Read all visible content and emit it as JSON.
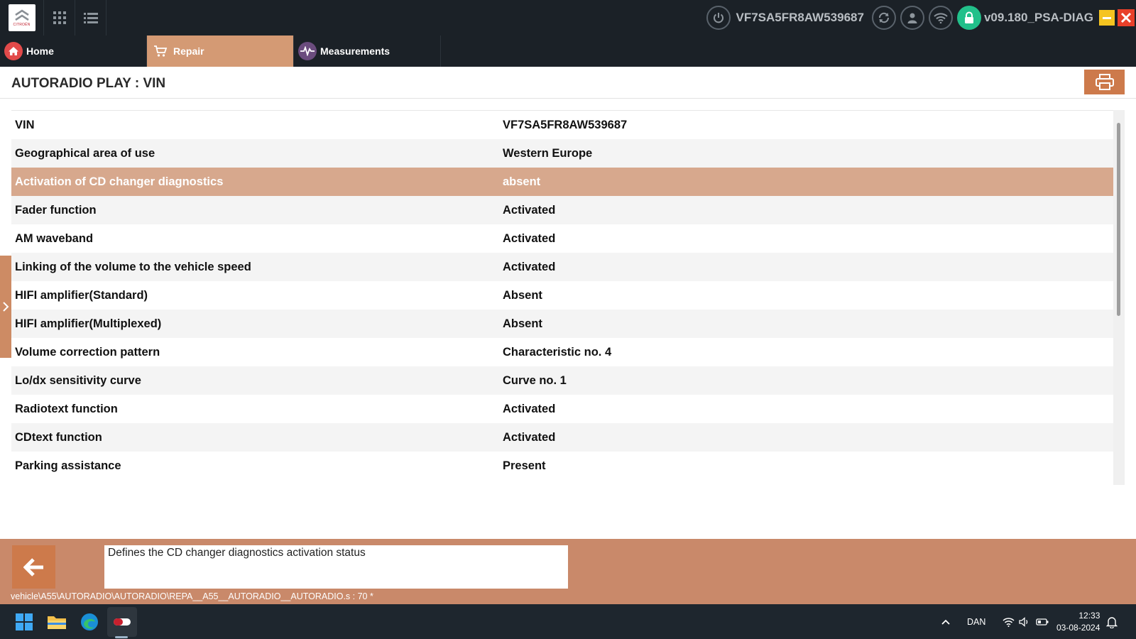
{
  "header": {
    "logo_brand": "CITROËN",
    "vin": "VF7SA5FR8AW539687",
    "version": "v09.180_PSA-DIAG",
    "icons": [
      "citroen-logo",
      "apps-grid-icon",
      "list-icon",
      "power-icon",
      "refresh-icon",
      "user-icon",
      "wifi-icon",
      "lock-icon",
      "minimize-icon",
      "close-icon"
    ]
  },
  "nav": {
    "tabs": [
      {
        "label": "Home",
        "icon": "home-icon"
      },
      {
        "label": "Repair",
        "icon": "cart-icon"
      },
      {
        "label": "Measurements",
        "icon": "pulse-icon"
      }
    ],
    "active_tab": "Repair"
  },
  "page": {
    "title": "AUTORADIO PLAY : VIN"
  },
  "table": {
    "rows": [
      {
        "label": "VIN",
        "value": "VF7SA5FR8AW539687"
      },
      {
        "label": "Geographical area of use",
        "value": "Western Europe"
      },
      {
        "label": "Activation of CD changer diagnostics",
        "value": "absent"
      },
      {
        "label": "Fader function",
        "value": "Activated"
      },
      {
        "label": "AM waveband",
        "value": "Activated"
      },
      {
        "label": "Linking of the volume to the vehicle speed",
        "value": "Activated"
      },
      {
        "label": "HIFI amplifier(Standard)",
        "value": "Absent"
      },
      {
        "label": "HIFI amplifier(Multiplexed)",
        "value": "Absent"
      },
      {
        "label": "Volume correction pattern",
        "value": "Characteristic no. 4"
      },
      {
        "label": "Lo/dx sensitivity curve",
        "value": "Curve no. 1"
      },
      {
        "label": "Radiotext function",
        "value": "Activated"
      },
      {
        "label": "CDtext function",
        "value": "Activated"
      },
      {
        "label": "Parking assistance",
        "value": "Present"
      }
    ],
    "selected_row": "Activation of CD changer diagnostics"
  },
  "bottom": {
    "description": "Defines the CD changer diagnostics activation status",
    "path": "vehicle\\A55\\AUTORADIO\\AUTORADIO\\REPA__A55__AUTORADIO__AUTORADIO.s : 70 *"
  },
  "taskbar": {
    "language": "DAN",
    "time": "12:33",
    "date": "03-08-2024"
  },
  "colors": {
    "topbar": "#1b2127",
    "accent": "#cd7a4b",
    "active_tab": "#d49a74",
    "selected_row": "#d7a88d",
    "bottom_panel": "#c9896a",
    "lock_green": "#22c08a"
  }
}
